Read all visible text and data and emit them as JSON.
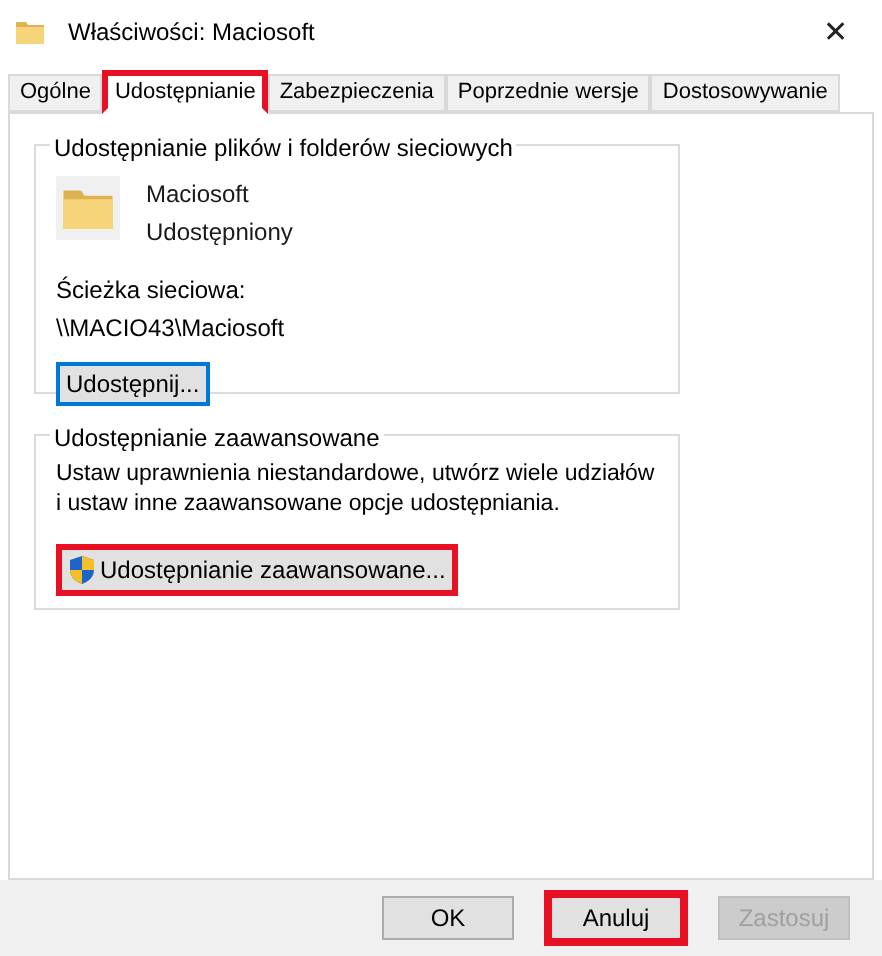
{
  "window": {
    "title": "Właściwości: Maciosoft",
    "close": "✕"
  },
  "tabs": [
    {
      "label": "Ogólne",
      "selected": false,
      "highlighted": false
    },
    {
      "label": "Udostępnianie",
      "selected": true,
      "highlighted": true
    },
    {
      "label": "Zabezpieczenia",
      "selected": false,
      "highlighted": false
    },
    {
      "label": "Poprzednie wersje",
      "selected": false,
      "highlighted": false
    },
    {
      "label": "Dostosowywanie",
      "selected": false,
      "highlighted": false
    }
  ],
  "file_sharing": {
    "title": "Udostępnianie plików i folderów sieciowych",
    "name": "Maciosoft",
    "status": "Udostępniony",
    "path_label": "Ścieżka sieciowa:",
    "path": "\\\\MACIO43\\Maciosoft",
    "button": {
      "label": "Udostępnij...",
      "focused": true,
      "highlighted": false
    }
  },
  "advanced_sharing": {
    "title": "Udostępnianie zaawansowane",
    "description": "Ustaw uprawnienia niestandardowe, utwórz wiele udziałów i ustaw inne zaawansowane opcje udostępniania.",
    "button": {
      "label": "Udostępnianie zaawansowane...",
      "highlighted": true
    }
  },
  "buttons": [
    {
      "label": "OK",
      "disabled": false,
      "highlighted": false
    },
    {
      "label": "Anuluj",
      "disabled": false,
      "highlighted": true
    },
    {
      "label": "Zastosuj",
      "disabled": true,
      "highlighted": false
    }
  ]
}
